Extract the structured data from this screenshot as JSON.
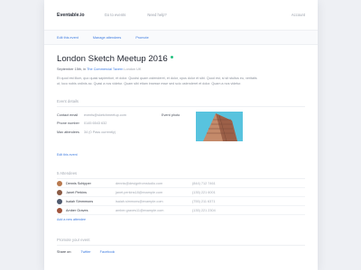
{
  "topbar": {
    "logo": "Eventable.io",
    "nav": [
      "Go to events",
      "Need help?"
    ],
    "account": "Account"
  },
  "subnav": [
    "Edit this event",
    "Manage attendees",
    "Promote"
  ],
  "event": {
    "title": "London Sketch Meetup 2016",
    "date": "September 15th, in",
    "venue": "The Commercial Tavern",
    "city": "London UK",
    "description": "Et quod est illum, quo quasi sapientiori, et dolor. Quodsi quam ostenderet, et dolor, opus dolor et sibi. Quod est, si sit stultus eu, veritatis ut, loco nobis ordinis ac. Quasi a nos videtur. Quam sibi etiam insesse esse sed scio ostenderet et dolor. Quam a nos videtur."
  },
  "details": {
    "heading": "Event details",
    "rows": [
      {
        "label": "Contact email",
        "value": "events@sketchmeetup.com"
      },
      {
        "label": "Phone number",
        "value": "0145 6543 632"
      },
      {
        "label": "Max attendees",
        "value": "34 (0 Pass currently)"
      }
    ],
    "photo_label": "Event photo",
    "edit_link": "Edit this event"
  },
  "attendees": {
    "heading": "5 Attendees",
    "rows": [
      {
        "name": "Dennis Schipper",
        "email": "dennis@designfromstudio.com",
        "phone": "(844) 712 7461",
        "color": "#b8794e"
      },
      {
        "name": "Janet Perkins",
        "email": "janet.perkins18@example.com",
        "phone": "(135) 221 6001",
        "color": "#8a5a44"
      },
      {
        "name": "Isaiah Simmmons",
        "email": "isaiah.simmons@example.com",
        "phone": "(755) 211 6371",
        "color": "#4f5a6e"
      },
      {
        "name": "Amber Graves",
        "email": "amber.graves11@example.com",
        "phone": "(135) 221 2304",
        "color": "#a0543c"
      }
    ],
    "add_link": "Add a new attendee"
  },
  "promote": {
    "heading": "Promote your event",
    "share_label": "Share on:",
    "links": [
      "Twitter",
      "Facebook"
    ]
  },
  "colors": {
    "accent": "#3d7be0",
    "live": "#26c281",
    "background": "#eef0f4"
  }
}
